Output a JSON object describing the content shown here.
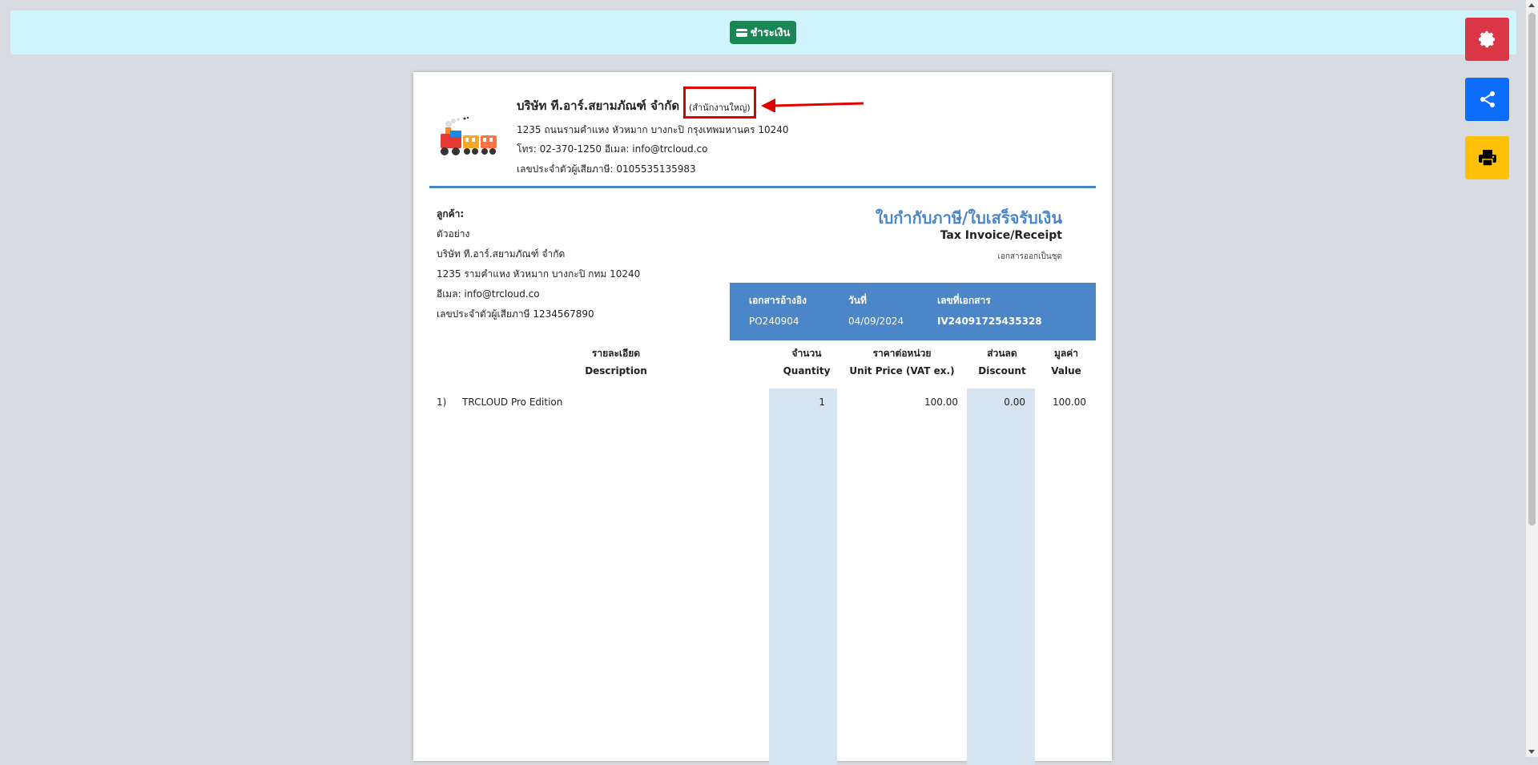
{
  "topbar": {
    "pay_label": "ชำระเงิน"
  },
  "side_buttons": {
    "settings_icon": "gear-icon",
    "share_icon": "share-icon",
    "print_icon": "printer-icon"
  },
  "company": {
    "name": "บริษัท ที.อาร์.สยามภัณฑ์ จำกัด",
    "branch": "(สำนักงานใหญ่)",
    "address": "1235 ถนนรามคำแหง หัวหมาก บางกะปิ กรุงเทพมหานคร 10240",
    "contact": "โทร: 02-370-1250 อีเมล: info@trcloud.co",
    "tax_id": "เลขประจำตัวผู้เสียภาษี: 0105535135983"
  },
  "customer": {
    "label": "ลูกค้า:",
    "name": "ตัวอย่าง",
    "company": "บริษัท ที.อาร์.สยามภัณฑ์ จำกัด",
    "address": "1235 รามคำแหง หัวหมาก บางกะปิ กทม 10240",
    "email": "อีเมล: info@trcloud.co",
    "tax_id": "เลขประจำตัวผู้เสียภาษี 1234567890"
  },
  "document": {
    "title_th": "ใบกำกับภาษี/ใบเสร็จรับเงิน",
    "title_en": "Tax Invoice/Receipt",
    "note": "เอกสารออกเป็นชุด"
  },
  "reference": {
    "ref_label": "เอกสารอ้างอิง",
    "date_label": "วันที่",
    "docno_label": "เลขที่เอกสาร",
    "ref_value": "PO240904",
    "date_value": "04/09/2024",
    "docno_value": "IV24091725435328"
  },
  "table": {
    "headers": {
      "desc_th": "รายละเอียด",
      "desc_en": "Description",
      "qty_th": "จำนวน",
      "qty_en": "Quantity",
      "price_th": "ราคาต่อหน่วย",
      "price_en": "Unit Price (VAT ex.)",
      "disc_th": "ส่วนลด",
      "disc_en": "Discount",
      "value_th": "มูลค่า",
      "value_en": "Value"
    },
    "rows": [
      {
        "no": "1)",
        "desc": "TRCLOUD Pro Edition",
        "qty": "1",
        "price": "100.00",
        "discount": "0.00",
        "value": "100.00"
      }
    ]
  }
}
